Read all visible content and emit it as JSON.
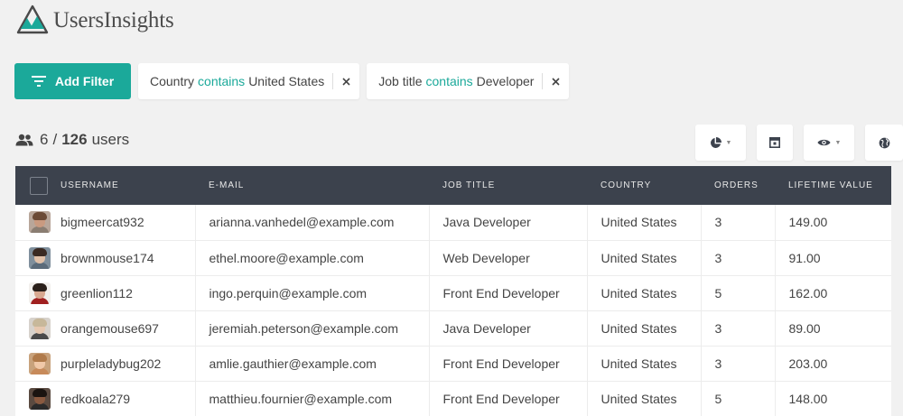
{
  "app": {
    "name": "UsersInsights",
    "brand_color": "#1ba99a",
    "header_bg": "#3c424d"
  },
  "filter_bar": {
    "add_filter_label": "Add Filter",
    "filters": [
      {
        "field": "Country",
        "operator": "contains",
        "value": "United States"
      },
      {
        "field": "Job title",
        "operator": "contains",
        "value": "Developer"
      }
    ]
  },
  "summary": {
    "shown": "6",
    "separator": "/",
    "total": "126",
    "unit": "users"
  },
  "toolbar": {
    "buttons": [
      {
        "icon": "pie-chart-icon",
        "has_dropdown": true
      },
      {
        "icon": "columns-icon",
        "has_dropdown": false
      },
      {
        "icon": "eye-icon",
        "has_dropdown": true
      },
      {
        "icon": "globe-icon",
        "has_dropdown": false
      }
    ]
  },
  "table": {
    "columns": [
      "USERNAME",
      "E-MAIL",
      "JOB TITLE",
      "COUNTRY",
      "ORDERS",
      "LIFETIME VALUE"
    ],
    "rows": [
      {
        "username": "bigmeercat932",
        "email": "arianna.vanhedel@example.com",
        "job_title": "Java Developer",
        "country": "United States",
        "orders": "3",
        "lifetime_value": "149.00",
        "avatar": {
          "skin": "#c99a80",
          "hair": "#6b4a36",
          "shirt": "#8a7d72",
          "bg": "#b8a69a"
        }
      },
      {
        "username": "brownmouse174",
        "email": "ethel.moore@example.com",
        "job_title": "Web Developer",
        "country": "United States",
        "orders": "3",
        "lifetime_value": "91.00",
        "avatar": {
          "skin": "#e0c0a8",
          "hair": "#3a2a22",
          "shirt": "#5b6b7a",
          "bg": "#7f8f9c"
        }
      },
      {
        "username": "greenlion112",
        "email": "ingo.perquin@example.com",
        "job_title": "Front End Developer",
        "country": "United States",
        "orders": "5",
        "lifetime_value": "162.00",
        "avatar": {
          "skin": "#d8a890",
          "hair": "#2a1f1a",
          "shirt": "#a02020",
          "bg": "#f2efec"
        }
      },
      {
        "username": "orangemouse697",
        "email": "jeremiah.peterson@example.com",
        "job_title": "Java Developer",
        "country": "United States",
        "orders": "3",
        "lifetime_value": "89.00",
        "avatar": {
          "skin": "#e6c8b0",
          "hair": "#c7b89a",
          "shirt": "#4a4a4a",
          "bg": "#d7d2cc"
        }
      },
      {
        "username": "purpleladybug202",
        "email": "amlie.gauthier@example.com",
        "job_title": "Front End Developer",
        "country": "United States",
        "orders": "3",
        "lifetime_value": "203.00",
        "avatar": {
          "skin": "#f0c8a8",
          "hair": "#b07a4a",
          "shirt": "#c78a5a",
          "bg": "#c8a27c"
        }
      },
      {
        "username": "redkoala279",
        "email": "matthieu.fournier@example.com",
        "job_title": "Front End Developer",
        "country": "United States",
        "orders": "5",
        "lifetime_value": "148.00",
        "avatar": {
          "skin": "#8a5a40",
          "hair": "#1a1410",
          "shirt": "#2a2a2a",
          "bg": "#5a4a40"
        }
      }
    ]
  }
}
